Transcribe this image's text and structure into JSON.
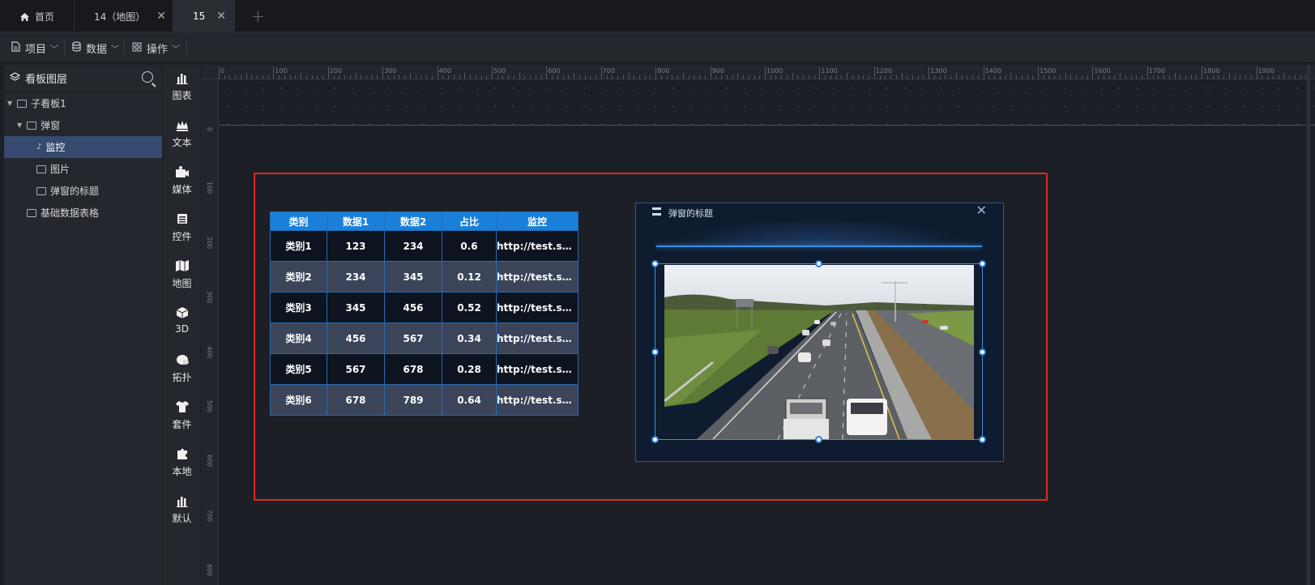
{
  "tabs": [
    {
      "label": "首页",
      "icon": "home-icon",
      "active": false
    },
    {
      "label": "14（地图）",
      "active": false
    },
    {
      "label": "15",
      "active": true
    }
  ],
  "menubar": [
    {
      "label": "项目",
      "icon": "file-icon"
    },
    {
      "label": "数据",
      "icon": "database-icon"
    },
    {
      "label": "操作",
      "icon": "grid-icon"
    }
  ],
  "layers": {
    "title": "看板图层",
    "items": [
      {
        "label": "子看板1"
      },
      {
        "label": "弹窗"
      },
      {
        "label": "监控",
        "selected": true
      },
      {
        "label": "图片"
      },
      {
        "label": "弹窗的标题"
      },
      {
        "label": "基础数据表格"
      }
    ]
  },
  "rail": [
    {
      "label": "图表",
      "icon": "bar-chart-icon"
    },
    {
      "label": "文本",
      "icon": "text-icon"
    },
    {
      "label": "媒体",
      "icon": "camera-icon"
    },
    {
      "label": "控件",
      "icon": "widget-icon"
    },
    {
      "label": "地图",
      "icon": "map-icon"
    },
    {
      "label": "3D",
      "icon": "cube-icon"
    },
    {
      "label": "拓扑",
      "icon": "topology-icon"
    },
    {
      "label": "套件",
      "icon": "shirt-icon"
    },
    {
      "label": "本地",
      "icon": "puzzle-icon"
    },
    {
      "label": "默认",
      "icon": "bar-chart-icon"
    }
  ],
  "ruler": {
    "top_labels": [
      "0",
      "100",
      "200",
      "300",
      "400",
      "500",
      "600",
      "700",
      "800",
      "900",
      "1000",
      "1100",
      "1200",
      "1300",
      "1400",
      "1500",
      "1600",
      "1700",
      "1800",
      "1900"
    ],
    "left_labels": [
      "0",
      "100",
      "200",
      "300",
      "400",
      "500",
      "600",
      "700",
      "800"
    ]
  },
  "table": {
    "headers": [
      "类别",
      "数据1",
      "数据2",
      "占比",
      "监控"
    ],
    "rows": [
      [
        "类别1",
        "123",
        "234",
        "0.6",
        "http://test.sha..."
      ],
      [
        "类别2",
        "234",
        "345",
        "0.12",
        "http://test.sha..."
      ],
      [
        "类别3",
        "345",
        "456",
        "0.52",
        "http://test.sha..."
      ],
      [
        "类别4",
        "456",
        "567",
        "0.34",
        "http://test.sha..."
      ],
      [
        "类别5",
        "567",
        "678",
        "0.28",
        "http://test.sha..."
      ],
      [
        "类别6",
        "678",
        "789",
        "0.64",
        "http://test.sha..."
      ]
    ]
  },
  "popup": {
    "title": "弹窗的标题",
    "close_icon": "close-icon"
  },
  "colors": {
    "accent": "#1a7fd8",
    "selection": "#e02b22",
    "selected_layer": "#354a6e"
  }
}
